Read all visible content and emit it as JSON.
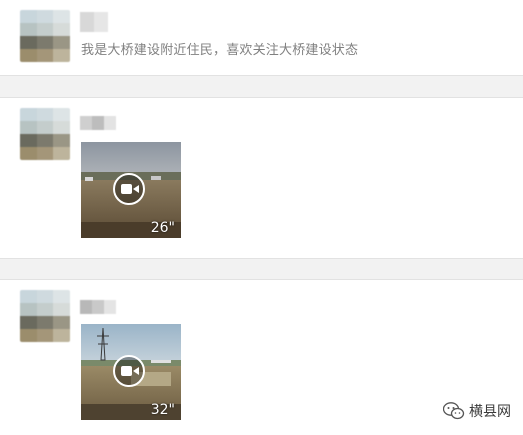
{
  "comments": [
    {
      "text": "我是大桥建设附近住民，喜欢关注大桥建设状态"
    },
    {
      "video": {
        "duration": "26\""
      }
    },
    {
      "video": {
        "duration": "32\""
      }
    }
  ],
  "watermark": {
    "label": "横县网"
  },
  "icons": [
    "video-camera-icon",
    "wechat-logo-icon"
  ]
}
